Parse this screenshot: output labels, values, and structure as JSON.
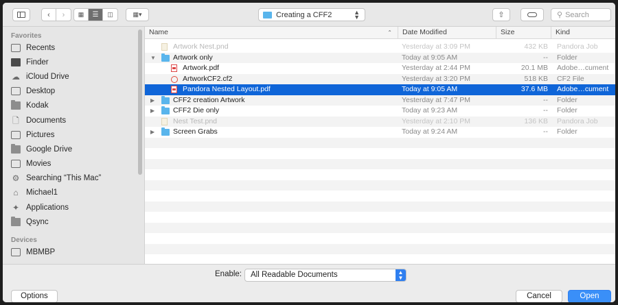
{
  "toolbar": {
    "location": "Creating a CFF2",
    "search_placeholder": "Search"
  },
  "sidebar": {
    "favorites_label": "Favorites",
    "devices_label": "Devices",
    "favorites": [
      {
        "label": "Recents",
        "icon": "recents-icon"
      },
      {
        "label": "Finder",
        "icon": "finder-icon"
      },
      {
        "label": "iCloud Drive",
        "icon": "cloud-icon"
      },
      {
        "label": "Desktop",
        "icon": "desktop-icon"
      },
      {
        "label": "Kodak",
        "icon": "folder-icon"
      },
      {
        "label": "Documents",
        "icon": "documents-icon"
      },
      {
        "label": "Pictures",
        "icon": "camera-icon"
      },
      {
        "label": "Google Drive",
        "icon": "folder-icon"
      },
      {
        "label": "Movies",
        "icon": "film-icon"
      },
      {
        "label": "Searching “This Mac”",
        "icon": "gear-icon"
      },
      {
        "label": "Michael1",
        "icon": "home-icon"
      },
      {
        "label": "Applications",
        "icon": "applications-icon"
      },
      {
        "label": "Qsync",
        "icon": "folder-icon"
      }
    ],
    "devices": [
      {
        "label": "MBMBP",
        "icon": "laptop-icon"
      }
    ]
  },
  "columns": {
    "name": "Name",
    "date": "Date Modified",
    "size": "Size",
    "kind": "Kind"
  },
  "files": [
    {
      "name": "Artwork Nest.pnd",
      "date": "Yesterday at 3:09 PM",
      "size": "432 KB",
      "kind": "Pandora Job"
    },
    {
      "name": "Artwork only",
      "date": "Today at 9:05 AM",
      "size": "--",
      "kind": "Folder"
    },
    {
      "name": "Artwork.pdf",
      "date": "Yesterday at 2:44 PM",
      "size": "20.1 MB",
      "kind": "Adobe…cument"
    },
    {
      "name": "ArtworkCF2.cf2",
      "date": "Yesterday at 3:20 PM",
      "size": "518 KB",
      "kind": "CF2 File"
    },
    {
      "name": "Pandora Nested Layout.pdf",
      "date": "Today at 9:05 AM",
      "size": "37.6 MB",
      "kind": "Adobe…cument"
    },
    {
      "name": "CFF2 creation Artwork",
      "date": "Yesterday at 7:47 PM",
      "size": "--",
      "kind": "Folder"
    },
    {
      "name": "CFF2 Die only",
      "date": "Today at 9:23 AM",
      "size": "--",
      "kind": "Folder"
    },
    {
      "name": "Nest Test.pnd",
      "date": "Yesterday at 2:10 PM",
      "size": "136 KB",
      "kind": "Pandora Job"
    },
    {
      "name": "Screen Grabs",
      "date": "Today at 9:24 AM",
      "size": "--",
      "kind": "Folder"
    }
  ],
  "bottom": {
    "enable_label": "Enable:",
    "enable_value": "All Readable Documents",
    "options": "Options",
    "cancel": "Cancel",
    "open": "Open"
  },
  "colors": {
    "selection": "#0f65d8",
    "primary_button": "#3a8ff8",
    "folder": "#59b5ec"
  }
}
